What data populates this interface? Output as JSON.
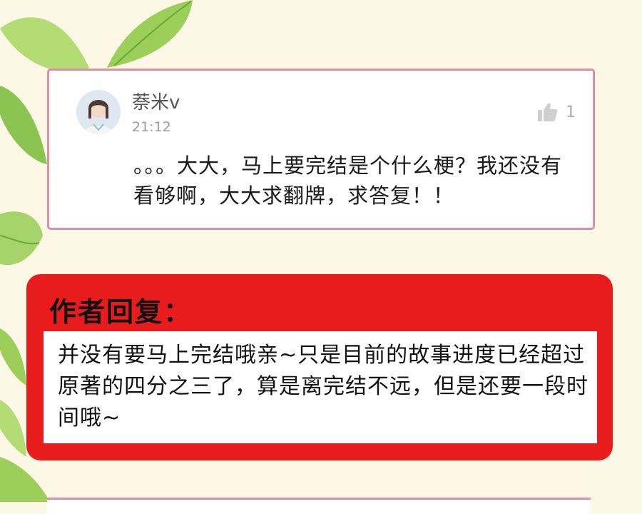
{
  "comment": {
    "username": "萘米v",
    "time": "21:12",
    "likes": "1",
    "text": "。。。大大，马上要完结是个什么梗？我还没有看够啊，大大求翻牌，求答复！！"
  },
  "author_reply": {
    "title": "作者回复：",
    "text": "并没有要马上完结哦亲~只是目前的故事进度已经超过原著的四分之三了，算是离完结不远，但是还要一段时间哦~"
  },
  "icons": {
    "like": "thumbs-up-icon",
    "avatar": "user-avatar-photo"
  },
  "colors": {
    "background": "#fdf8e6",
    "card_border": "#df8fa4",
    "reply_bg": "#e81c1c"
  }
}
